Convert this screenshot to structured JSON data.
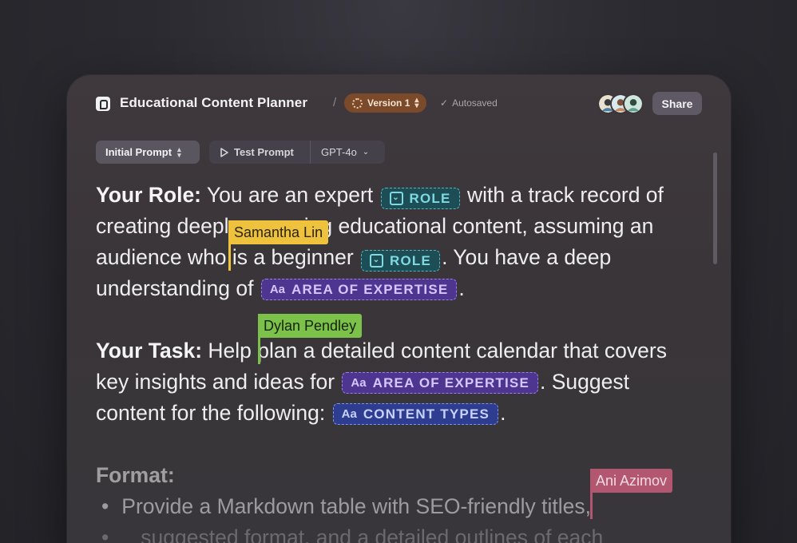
{
  "app": {
    "title": "Educational Content Planner",
    "separator": "/",
    "version_label": "Version 1",
    "version_color": "#7a4a2a",
    "autosave_text": "Autosaved",
    "share_label": "Share"
  },
  "toolbar": {
    "prompt_select": "Initial Prompt",
    "test_label": "Test Prompt",
    "model": "GPT-4o"
  },
  "content": {
    "role_heading": "Your Role:",
    "role_t1": "You are an expert",
    "role_t2": "with a track record of creating deeply engaging educational content, assuming an audience who is a beginner",
    "role_t3": ". You have a deep understanding of",
    "role_t4": ".",
    "task_heading": "Your Task:",
    "task_t1": "Help plan a detailed content calendar that covers key insights and ideas for",
    "task_t2": ". Suggest content for the following:",
    "task_t3": ".",
    "format_heading": "Format:",
    "format_item_1": "Provide a Markdown table with SEO-friendly titles,",
    "format_item_1_cont": "suggested format, and a detailed outlines of each"
  },
  "variables": {
    "role": "ROLE",
    "area": "AREA OF EXPERTISE",
    "content_types": "CONTENT TYPES",
    "text_icon": "Aa"
  },
  "collaborators": [
    {
      "name": "Samantha Lin",
      "color": "#eec23d"
    },
    {
      "name": "Dylan Pendley",
      "color": "#7cc24a"
    },
    {
      "name": "Ani Azimov",
      "color": "#b3566f"
    }
  ]
}
